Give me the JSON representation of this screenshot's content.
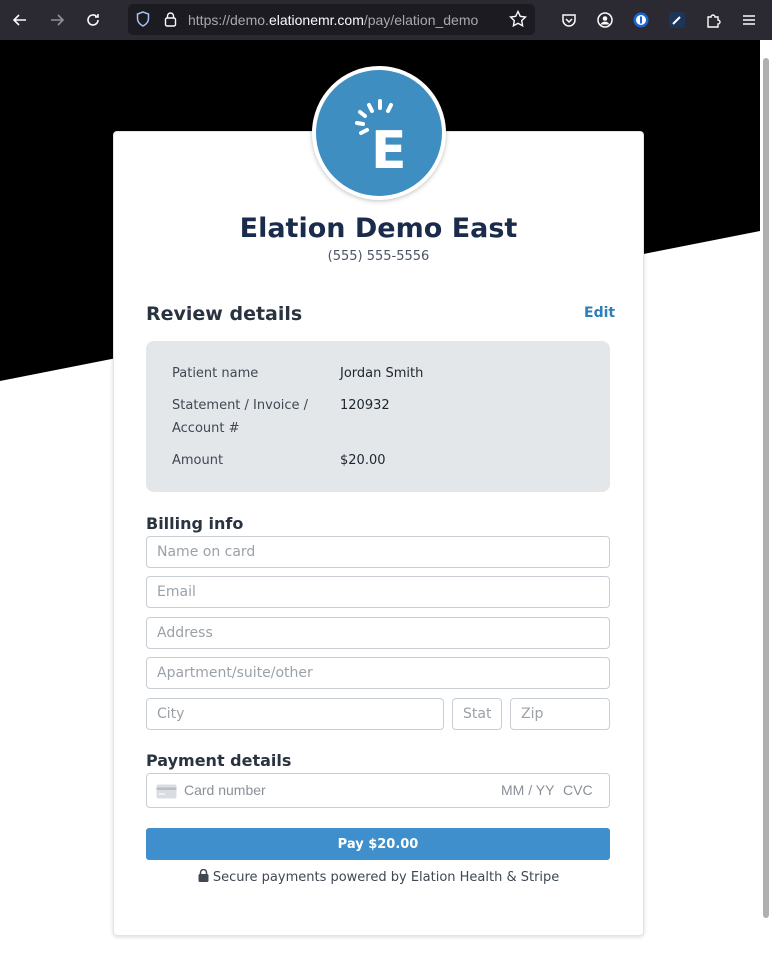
{
  "browser": {
    "url_prefix": "https://demo.",
    "url_domain": "elationemr.com",
    "url_path": "/pay/elation_demo"
  },
  "practice": {
    "name": "Elation Demo East",
    "phone": "(555) 555-5556",
    "logo_letter": "E"
  },
  "review": {
    "title": "Review details",
    "edit_label": "Edit",
    "rows": [
      {
        "label": "Patient name",
        "value": "Jordan Smith"
      },
      {
        "label_line1": "Statement / Invoice /",
        "label_line2": "Account #",
        "value": "120932"
      },
      {
        "label": "Amount",
        "value": "$20.00"
      }
    ]
  },
  "billing": {
    "title": "Billing info",
    "name_placeholder": "Name on card",
    "email_placeholder": "Email",
    "address_placeholder": "Address",
    "apt_placeholder": "Apartment/suite/other",
    "city_placeholder": "City",
    "state_placeholder": "State",
    "zip_placeholder": "Zip"
  },
  "payment": {
    "title": "Payment details",
    "card_placeholder": "Card number",
    "expiry_placeholder": "MM / YY",
    "cvc_placeholder": "CVC"
  },
  "pay_button": "Pay $20.00",
  "secure_text": "Secure payments powered by Elation Health & Stripe",
  "colors": {
    "brand": "#3e8ec2",
    "pay_button": "#3f8fcc",
    "title": "#1b2b4b",
    "review_bg": "#e3e7ea",
    "link": "#2c7fb8"
  }
}
